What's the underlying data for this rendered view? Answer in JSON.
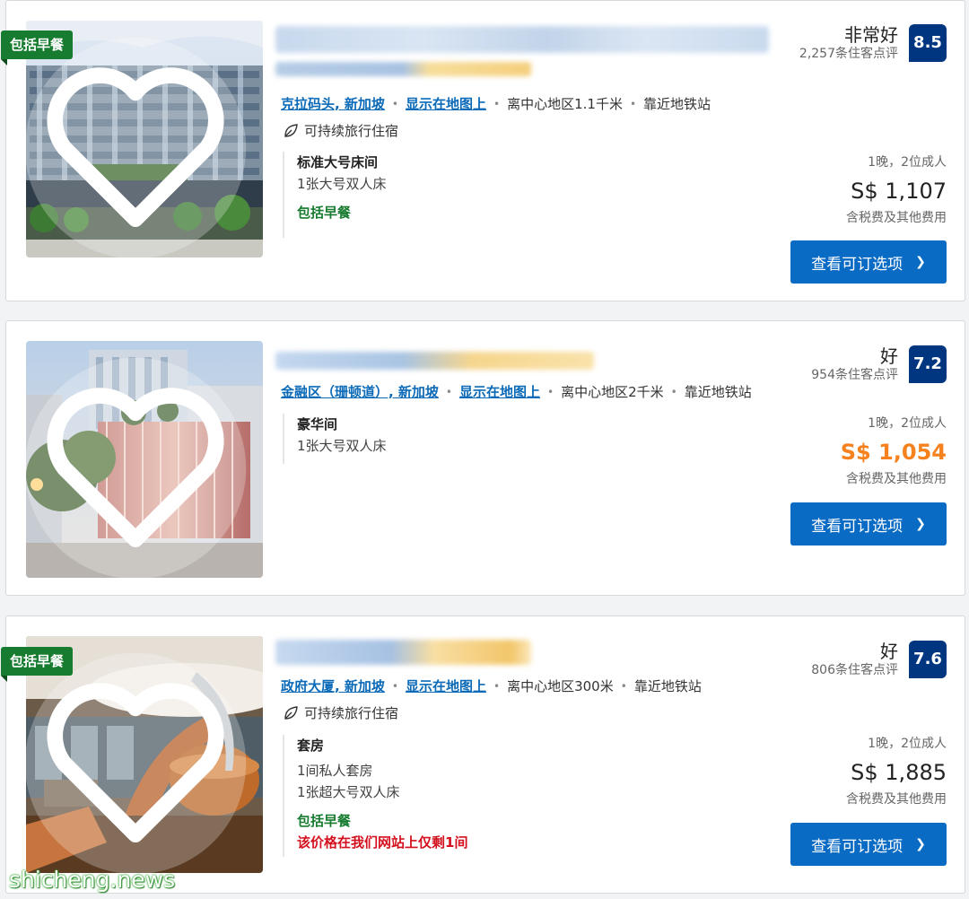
{
  "listings": [
    {
      "badge": "包括早餐",
      "location": "克拉码头, 新加坡",
      "map_link": "显示在地图上",
      "distance": "离中心地区1.1千米",
      "near_metro": "靠近地铁站",
      "sustainable": "可持续旅行住宿",
      "rating_word": "非常好",
      "review_count": "2,257条住客点评",
      "score": "8.5",
      "room_name": "标准大号床间",
      "room_lines": [
        "1张大号双人床"
      ],
      "breakfast": "包括早餐",
      "scarcity": "",
      "nights_guests": "1晚，2位成人",
      "price": "S$ 1,107",
      "tax_note": "含税费及其他费用",
      "button": "查看可订选项"
    },
    {
      "badge": "",
      "location": "金融区（珊顿道）, 新加坡",
      "map_link": "显示在地图上",
      "distance": "离中心地区2千米",
      "near_metro": "靠近地铁站",
      "sustainable": "",
      "rating_word": "好",
      "review_count": "954条住客点评",
      "score": "7.2",
      "room_name": "豪华间",
      "room_lines": [
        "1张大号双人床"
      ],
      "breakfast": "",
      "scarcity": "",
      "nights_guests": "1晚，2位成人",
      "price": "S$ 1,054",
      "tax_note": "含税费及其他费用",
      "button": "查看可订选项"
    },
    {
      "badge": "包括早餐",
      "location": "政府大厦, 新加坡",
      "map_link": "显示在地图上",
      "distance": "离中心地区300米",
      "near_metro": "靠近地铁站",
      "sustainable": "可持续旅行住宿",
      "rating_word": "好",
      "review_count": "806条住客点评",
      "score": "7.6",
      "room_name": "套房",
      "room_lines": [
        "1间私人套房",
        "1张超大号双人床"
      ],
      "breakfast": "包括早餐",
      "scarcity": "该价格在我们网站上仅剩1间",
      "nights_guests": "1晚，2位成人",
      "price": "S$ 1,885",
      "tax_note": "含税费及其他费用",
      "button": "查看可订选项"
    }
  ],
  "colors": {
    "brand_blue": "#003580",
    "button_blue": "#0a6bc4",
    "link_blue": "#0b6ab7",
    "breakfast_green": "#177b30",
    "deal_orange": "#f5821f",
    "scarcity_red": "#d4111e"
  },
  "icons": {
    "favorite": "heart-outline-icon",
    "sustainable": "leaf-icon",
    "button": "chevron-right-icon"
  },
  "watermark": "shicheng.news"
}
